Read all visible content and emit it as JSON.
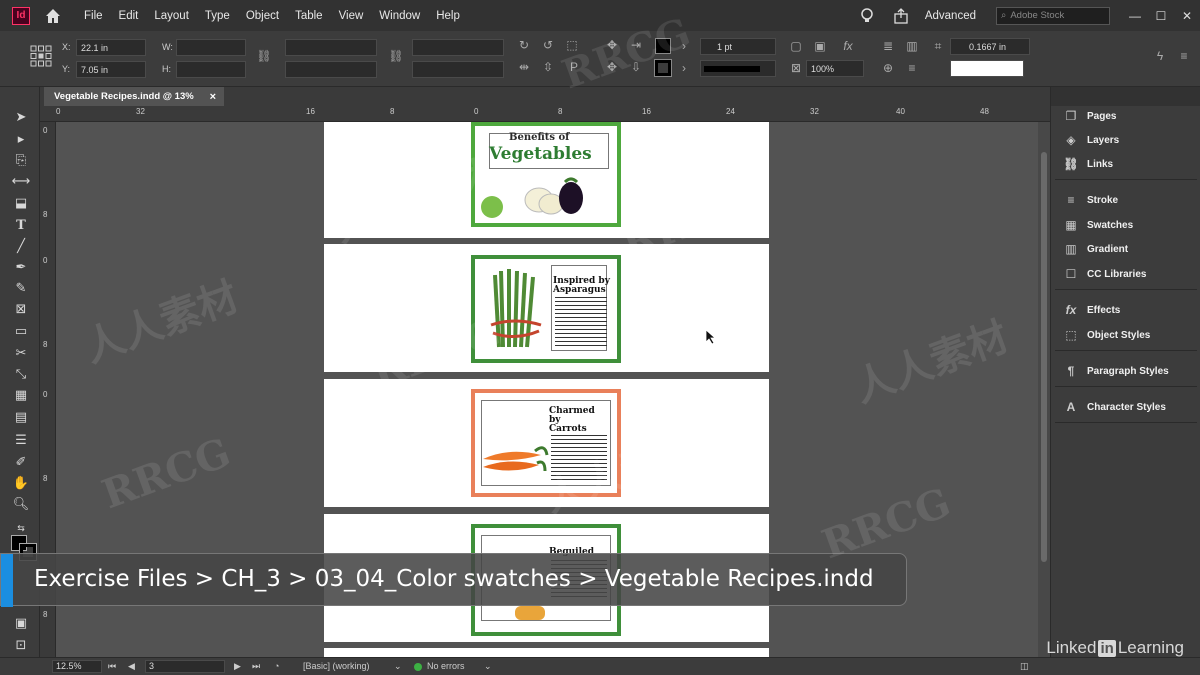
{
  "app": {
    "logo": "Id",
    "workspace": "Advanced",
    "stock_placeholder": "Adobe Stock"
  },
  "menu": [
    "File",
    "Edit",
    "Layout",
    "Type",
    "Object",
    "Table",
    "View",
    "Window",
    "Help"
  ],
  "control": {
    "x_label": "X:",
    "x_value": "22.1 in",
    "y_label": "Y:",
    "y_value": "7.05 in",
    "w_label": "W:",
    "h_label": "H:",
    "stroke_weight": "1 pt",
    "scale": "100%",
    "offset": "0.1667 in"
  },
  "document_tab": {
    "title": "Vegetable Recipes.indd @ 13%",
    "close": "×"
  },
  "ruler_h": [
    "0",
    "32",
    "16",
    "8",
    "0",
    "8",
    "16",
    "24",
    "32",
    "40",
    "48"
  ],
  "ruler_v": [
    "0",
    "8",
    "0",
    "8",
    "0",
    "8",
    "8"
  ],
  "cards": [
    {
      "title_line1": "Benefits of",
      "title_line2": "Vegetables",
      "color": "#4ea83d"
    },
    {
      "label": "Inspired by Asparagus",
      "color": "#3f8f3a"
    },
    {
      "label": "Charmed by Carrots",
      "color": "#e9805a"
    },
    {
      "label": "Beguiled",
      "color": "#3f8f3a"
    }
  ],
  "panels": [
    {
      "label": "Pages",
      "icon": "pages-icon"
    },
    {
      "label": "Layers",
      "icon": "layers-icon"
    },
    {
      "label": "Links",
      "icon": "links-icon"
    },
    {
      "label": "Stroke",
      "icon": "stroke-icon"
    },
    {
      "label": "Swatches",
      "icon": "swatches-icon"
    },
    {
      "label": "Gradient",
      "icon": "gradient-icon"
    },
    {
      "label": "CC Libraries",
      "icon": "cc-libraries-icon"
    },
    {
      "label": "Effects",
      "icon": "effects-icon"
    },
    {
      "label": "Object Styles",
      "icon": "object-styles-icon"
    },
    {
      "label": "Paragraph Styles",
      "icon": "paragraph-styles-icon"
    },
    {
      "label": "Character Styles",
      "icon": "character-styles-icon"
    }
  ],
  "status": {
    "zoom": "12.5%",
    "page": "3",
    "master": "[Basic] (working)",
    "errors": "No errors"
  },
  "breadcrumb": "Exercise Files > CH_3 > 03_04_Color swatches > Vegetable Recipes.indd",
  "brand": {
    "prefix": "Linked",
    "box": "in",
    "suffix": "Learning"
  },
  "watermarks": [
    "RRCG",
    "人人素材"
  ]
}
